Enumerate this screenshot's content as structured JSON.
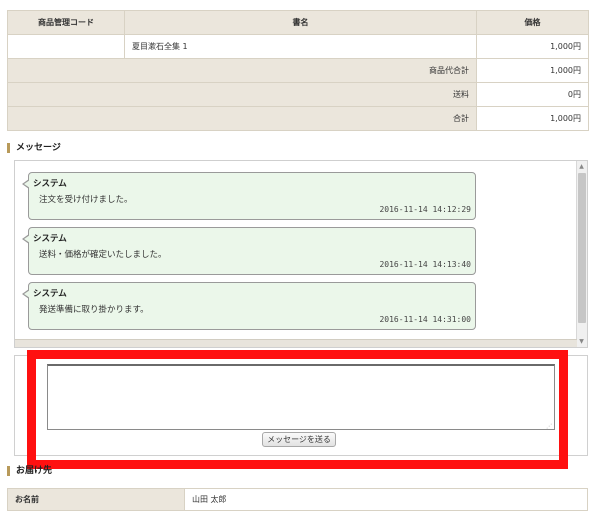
{
  "order_table": {
    "headers": {
      "code": "商品管理コード",
      "title": "書名",
      "price": "価格"
    },
    "item": {
      "code": "",
      "title": "夏目漱石全集 1",
      "price": "1,000円"
    },
    "subtotal": {
      "label": "商品代合計",
      "value": "1,000円"
    },
    "shipping": {
      "label": "送料",
      "value": "0円"
    },
    "total": {
      "label": "合計",
      "value": "1,000円"
    }
  },
  "messages_section": {
    "heading": "メッセージ",
    "messages": [
      {
        "sender": "システム",
        "text": "注文を受け付けました。",
        "time": "2016-11-14 14:12:29"
      },
      {
        "sender": "システム",
        "text": "送料・価格が確定いたしました。",
        "time": "2016-11-14 14:13:40"
      },
      {
        "sender": "システム",
        "text": "発送準備に取り掛かります。",
        "time": "2016-11-14 14:31:00"
      }
    ]
  },
  "compose": {
    "textarea_value": "",
    "send_label": "メッセージを送る"
  },
  "colors": {
    "highlight": "#ff1010",
    "bubble_bg": "#ebf7ea",
    "header_bg": "#ebe6dc"
  },
  "destination": {
    "heading": "お届け先",
    "name_label": "お名前",
    "name_value": "山田 太郎"
  }
}
